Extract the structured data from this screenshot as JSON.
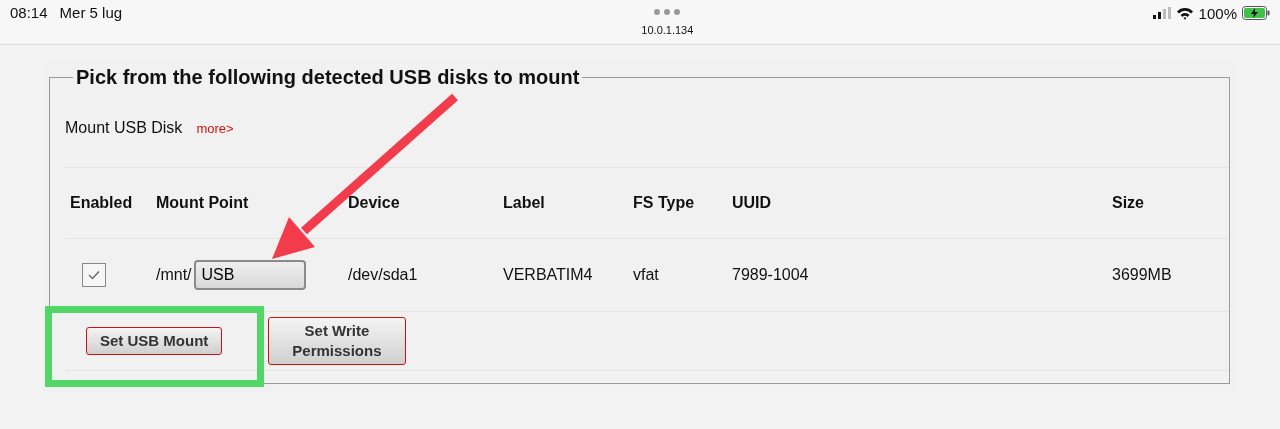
{
  "status_bar": {
    "time": "08:14",
    "date": "Mer 5 lug",
    "address": "10.0.1.134",
    "battery": "100%",
    "charging": true
  },
  "panel": {
    "title": "Pick from the following detected USB disks to mount",
    "section": "Mount USB Disk",
    "more_link": "more>"
  },
  "table": {
    "columns": [
      "Enabled",
      "Mount Point",
      "Device",
      "Label",
      "FS Type",
      "UUID",
      "Size"
    ],
    "rows": [
      {
        "enabled": true,
        "prefix": "/mnt/",
        "mount_point": "USB",
        "device": "/dev/sda1",
        "label": "VERBATIM4",
        "fs_type": "vfat",
        "uuid": "7989-1004",
        "size": "3699MB"
      }
    ]
  },
  "buttons": [
    "Set USB Mount",
    "Set Write\nPermissions"
  ]
}
